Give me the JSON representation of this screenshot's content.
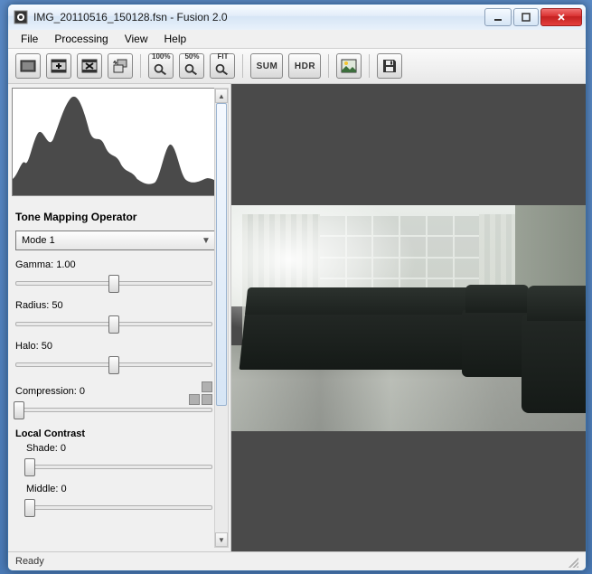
{
  "window": {
    "title": "IMG_20110516_150128.fsn - Fusion 2.0"
  },
  "menu": {
    "file": "File",
    "processing": "Processing",
    "view": "View",
    "help": "Help"
  },
  "toolbar": {
    "zoom100": "100%",
    "zoom50": "50%",
    "zoomFit": "FIT",
    "sum": "SUM",
    "hdr": "HDR"
  },
  "panel": {
    "section_title": "Tone Mapping Operator",
    "mode_selected": "Mode 1",
    "gamma_label": "Gamma: 1.00",
    "radius_label": "Radius: 50",
    "halo_label": "Halo: 50",
    "compression_label": "Compression: 0",
    "local_contrast_title": "Local Contrast",
    "shade_label": "Shade: 0",
    "middle_label": "Middle: 0"
  },
  "status": {
    "text": "Ready"
  }
}
